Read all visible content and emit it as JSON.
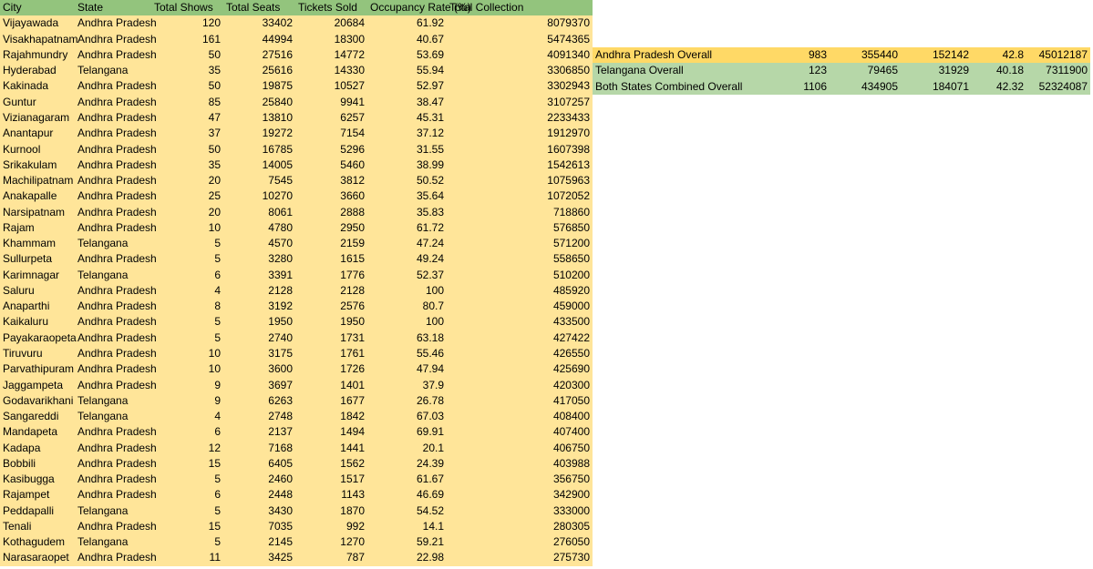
{
  "headers": [
    "City",
    "State",
    "Total Shows",
    "Total Seats",
    "Tickets Sold",
    "Occupancy Rate (%)",
    "Total Collection"
  ],
  "rows": [
    [
      "Vijayawada",
      "Andhra Pradesh",
      "120",
      "33402",
      "20684",
      "61.92",
      "8079370"
    ],
    [
      "Visakhapatnam",
      "Andhra Pradesh",
      "161",
      "44994",
      "18300",
      "40.67",
      "5474365"
    ],
    [
      "Rajahmundry",
      "Andhra Pradesh",
      "50",
      "27516",
      "14772",
      "53.69",
      "4091340"
    ],
    [
      "Hyderabad",
      "Telangana",
      "35",
      "25616",
      "14330",
      "55.94",
      "3306850"
    ],
    [
      "Kakinada",
      "Andhra Pradesh",
      "50",
      "19875",
      "10527",
      "52.97",
      "3302943"
    ],
    [
      "Guntur",
      "Andhra Pradesh",
      "85",
      "25840",
      "9941",
      "38.47",
      "3107257"
    ],
    [
      "Vizianagaram",
      "Andhra Pradesh",
      "47",
      "13810",
      "6257",
      "45.31",
      "2233433"
    ],
    [
      "Anantapur",
      "Andhra Pradesh",
      "37",
      "19272",
      "7154",
      "37.12",
      "1912970"
    ],
    [
      "Kurnool",
      "Andhra Pradesh",
      "50",
      "16785",
      "5296",
      "31.55",
      "1607398"
    ],
    [
      "Srikakulam",
      "Andhra Pradesh",
      "35",
      "14005",
      "5460",
      "38.99",
      "1542613"
    ],
    [
      "Machilipatnam",
      "Andhra Pradesh",
      "20",
      "7545",
      "3812",
      "50.52",
      "1075963"
    ],
    [
      "Anakapalle",
      "Andhra Pradesh",
      "25",
      "10270",
      "3660",
      "35.64",
      "1072052"
    ],
    [
      "Narsipatnam",
      "Andhra Pradesh",
      "20",
      "8061",
      "2888",
      "35.83",
      "718860"
    ],
    [
      "Rajam",
      "Andhra Pradesh",
      "10",
      "4780",
      "2950",
      "61.72",
      "576850"
    ],
    [
      "Khammam",
      "Telangana",
      "5",
      "4570",
      "2159",
      "47.24",
      "571200"
    ],
    [
      "Sullurpeta",
      "Andhra Pradesh",
      "5",
      "3280",
      "1615",
      "49.24",
      "558650"
    ],
    [
      "Karimnagar",
      "Telangana",
      "6",
      "3391",
      "1776",
      "52.37",
      "510200"
    ],
    [
      "Saluru",
      "Andhra Pradesh",
      "4",
      "2128",
      "2128",
      "100",
      "485920"
    ],
    [
      "Anaparthi",
      "Andhra Pradesh",
      "8",
      "3192",
      "2576",
      "80.7",
      "459000"
    ],
    [
      "Kaikaluru",
      "Andhra Pradesh",
      "5",
      "1950",
      "1950",
      "100",
      "433500"
    ],
    [
      "Payakaraopeta",
      "Andhra Pradesh",
      "5",
      "2740",
      "1731",
      "63.18",
      "427422"
    ],
    [
      "Tiruvuru",
      "Andhra Pradesh",
      "10",
      "3175",
      "1761",
      "55.46",
      "426550"
    ],
    [
      "Parvathipuram",
      "Andhra Pradesh",
      "10",
      "3600",
      "1726",
      "47.94",
      "425690"
    ],
    [
      "Jaggampeta",
      "Andhra Pradesh",
      "9",
      "3697",
      "1401",
      "37.9",
      "420300"
    ],
    [
      "Godavarikhani",
      "Telangana",
      "9",
      "6263",
      "1677",
      "26.78",
      "417050"
    ],
    [
      "Sangareddi",
      "Telangana",
      "4",
      "2748",
      "1842",
      "67.03",
      "408400"
    ],
    [
      "Mandapeta",
      "Andhra Pradesh",
      "6",
      "2137",
      "1494",
      "69.91",
      "407400"
    ],
    [
      "Kadapa",
      "Andhra Pradesh",
      "12",
      "7168",
      "1441",
      "20.1",
      "406750"
    ],
    [
      "Bobbili",
      "Andhra Pradesh",
      "15",
      "6405",
      "1562",
      "24.39",
      "403988"
    ],
    [
      "Kasibugga",
      "Andhra Pradesh",
      "5",
      "2460",
      "1517",
      "61.67",
      "356750"
    ],
    [
      "Rajampet",
      "Andhra Pradesh",
      "6",
      "2448",
      "1143",
      "46.69",
      "342900"
    ],
    [
      "Peddapalli",
      "Telangana",
      "5",
      "3430",
      "1870",
      "54.52",
      "333000"
    ],
    [
      "Tenali",
      "Andhra Pradesh",
      "15",
      "7035",
      "992",
      "14.1",
      "280305"
    ],
    [
      "Kothagudem",
      "Telangana",
      "5",
      "2145",
      "1270",
      "59.21",
      "276050"
    ],
    [
      "Narasaraopet",
      "Andhra Pradesh",
      "11",
      "3425",
      "787",
      "22.98",
      "275730"
    ]
  ],
  "summary": [
    [
      "Andhra Pradesh Overall",
      "983",
      "355440",
      "152142",
      "42.8",
      "45012187"
    ],
    [
      "Telangana Overall",
      "123",
      "79465",
      "31929",
      "40.18",
      "7311900"
    ],
    [
      "Both States Combined Overall",
      "1106",
      "434905",
      "184071",
      "42.32",
      "52324087"
    ]
  ],
  "colors": {
    "header_green": "#93c47d",
    "row_yellow": "#ffe599",
    "summary_ap": "#ffd966",
    "summary_green": "#b6d7a8"
  }
}
